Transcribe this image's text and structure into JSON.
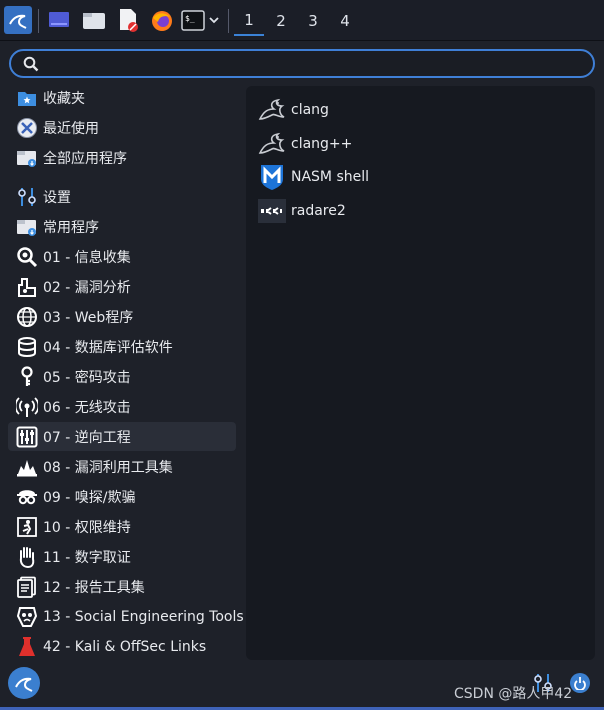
{
  "taskbar": {
    "workspaces": [
      "1",
      "2",
      "3",
      "4"
    ],
    "active_workspace": "1",
    "icons": [
      "kali-menu-icon",
      "desktop-icon",
      "file-manager-icon",
      "text-editor-icon",
      "firefox-icon",
      "terminal-icon",
      "chevron-down-icon"
    ]
  },
  "search": {
    "value": "",
    "placeholder": ""
  },
  "sidebar": {
    "items": [
      {
        "label": "收藏夹",
        "icon": "star-folder-icon"
      },
      {
        "label": "最近使用",
        "icon": "recent-icon"
      },
      {
        "label": "全部应用程序",
        "icon": "all-apps-icon"
      },
      {
        "label": "设置",
        "icon": "settings-icon"
      },
      {
        "label": "常用程序",
        "icon": "usual-apps-icon"
      },
      {
        "label": "01 - 信息收集",
        "icon": "magnifier-icon"
      },
      {
        "label": "02 - 漏洞分析",
        "icon": "vuln-analysis-icon"
      },
      {
        "label": "03 - Web程序",
        "icon": "globe-icon"
      },
      {
        "label": "04 - 数据库评估软件",
        "icon": "database-icon"
      },
      {
        "label": "05 - 密码攻击",
        "icon": "key-icon"
      },
      {
        "label": "06 - 无线攻击",
        "icon": "wireless-icon"
      },
      {
        "label": "07 - 逆向工程",
        "icon": "reverse-engineering-icon"
      },
      {
        "label": "08 - 漏洞利用工具集",
        "icon": "exploit-icon"
      },
      {
        "label": "09 - 嗅探/欺骗",
        "icon": "sniffing-icon"
      },
      {
        "label": "10 - 权限维持",
        "icon": "maintain-access-icon"
      },
      {
        "label": "11 - 数字取证",
        "icon": "forensics-hand-icon"
      },
      {
        "label": "12 - 报告工具集",
        "icon": "reporting-icon"
      },
      {
        "label": "13 - Social Engineering Tools",
        "icon": "social-engineering-icon"
      },
      {
        "label": "42 - Kali & OffSec Links",
        "icon": "offsec-icon"
      }
    ],
    "selected": "07 - 逆向工程"
  },
  "apps": [
    {
      "label": "clang",
      "icon": "dragon-icon"
    },
    {
      "label": "clang++",
      "icon": "dragon-icon"
    },
    {
      "label": "NASM shell",
      "icon": "metasploit-icon"
    },
    {
      "label": "radare2",
      "icon": "radare2-icon"
    }
  ],
  "footer": {
    "watermark": "CSDN @路人甲42"
  },
  "colors": {
    "accent": "#3b82d6",
    "background": "#1e2129",
    "panel": "#161920",
    "selected": "#2a2e38"
  }
}
